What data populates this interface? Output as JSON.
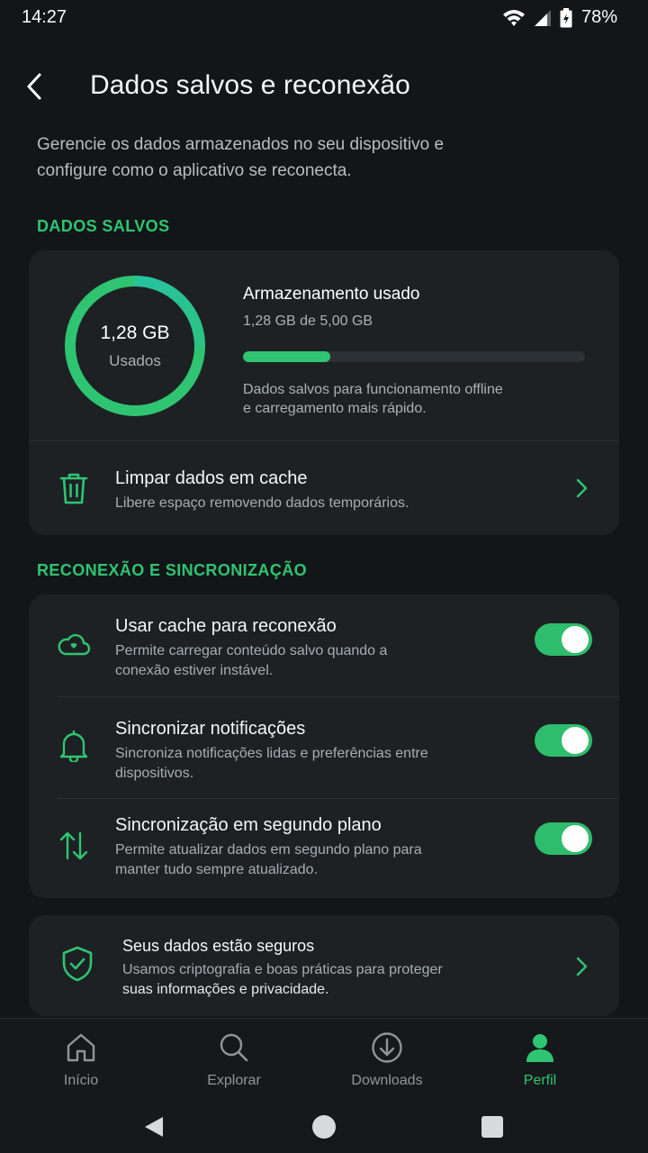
{
  "status_bar": {
    "time": "14:27",
    "battery": "78%"
  },
  "header": {
    "title": "Dados salvos e reconexão"
  },
  "description": "Gerencie os dados armazenados no seu dispositivo e configure como o aplicativo se reconecta.",
  "saved_data": {
    "section_label": "DADOS SALVOS",
    "donut_value": "1,28 GB",
    "donut_caption": "Usados",
    "used_fraction": 0.256,
    "storage_title": "Armazenamento usado",
    "storage_amount": "1,28 GB de 5,00 GB",
    "storage_note": "Dados salvos para funcionamento offline e carregamento mais rápido.",
    "clear_cache": {
      "title": "Limpar dados em cache",
      "subtitle": "Libere espaço removendo dados temporários.",
      "icon": "trash-icon"
    }
  },
  "sync": {
    "section_label": "RECONEXÃO E SINCRONIZAÇÃO",
    "items": [
      {
        "title": "Usar cache para reconexão",
        "subtitle": "Permite carregar conteúdo salvo quando a conexão estiver instável.",
        "icon": "cloud-icon",
        "enabled": true
      },
      {
        "title": "Sincronizar notificações",
        "subtitle": "Sincroniza notificações lidas e preferências entre dispositivos.",
        "icon": "bell-icon",
        "enabled": true
      },
      {
        "title": "Sincronização em segundo plano",
        "subtitle": "Permite atualizar dados em segundo plano para manter tudo sempre atualizado.",
        "icon": "arrows-up-down-icon",
        "enabled": true
      }
    ]
  },
  "security": {
    "title": "Seus dados estão seguros",
    "subtitle_line1": "Usamos criptografia e boas práticas para proteger",
    "subtitle_line2": "suas informações e privacidade.",
    "icon": "shield-check-icon"
  },
  "bottom_nav": {
    "items": [
      {
        "label": "Início",
        "icon": "home-icon",
        "active": false
      },
      {
        "label": "Explorar",
        "icon": "search-icon",
        "active": false
      },
      {
        "label": "Downloads",
        "icon": "download-icon",
        "active": false
      },
      {
        "label": "Perfil",
        "icon": "profile-icon",
        "active": true
      }
    ]
  },
  "colors": {
    "accent": "#2fc472",
    "accent_teal": "#22c1b0",
    "background": "#131618",
    "card": "#1d2124"
  }
}
